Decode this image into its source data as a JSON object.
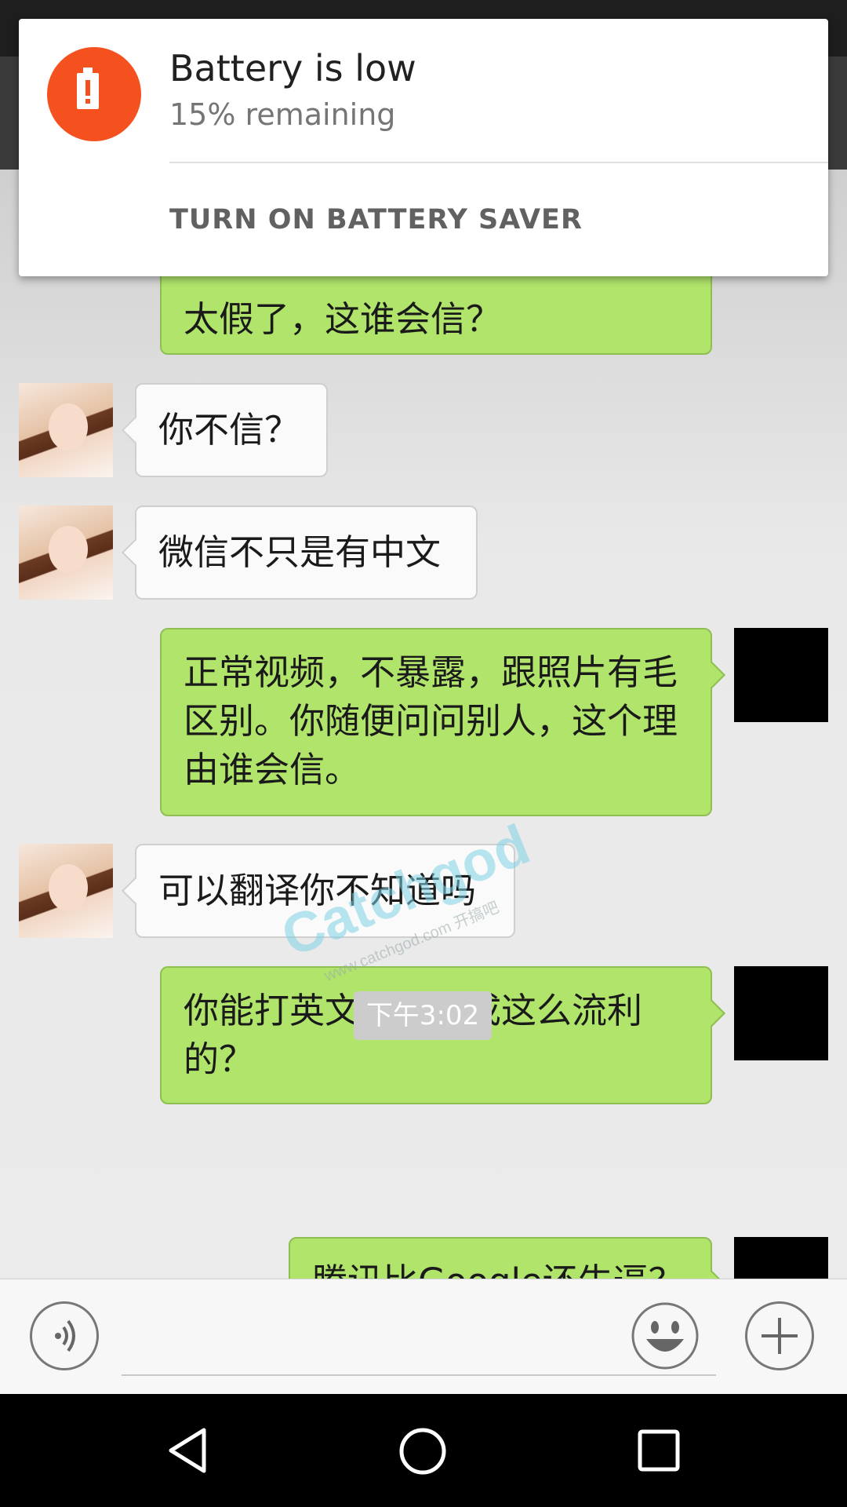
{
  "notification": {
    "title": "Battery is low",
    "subtitle": "15% remaining",
    "action": "TURN ON BATTERY SAVER",
    "accent": "#f4511e"
  },
  "messages": [
    {
      "side": "out",
      "text": "太假了，这谁会信？"
    },
    {
      "side": "in",
      "text": "你不信？"
    },
    {
      "side": "in",
      "text": "微信不只是有中文"
    },
    {
      "side": "out",
      "text": "正常视频，不暴露，跟照片有毛区别。你随便问问别人，这个理由谁会信。"
    },
    {
      "side": "in",
      "text": "可以翻译你不知道吗"
    },
    {
      "side": "out",
      "text": "你能打英文，翻译成这么流利的？"
    },
    {
      "side": "out",
      "text": "腾讯比Google还牛逼？"
    }
  ],
  "timestamp": "下午3:02",
  "watermark": {
    "brand": "Catchgod",
    "url": "www.catchgod.com 开搞吧"
  },
  "input_bar": {
    "voice_icon": "voice-icon",
    "emoji_icon": "emoji-icon",
    "plus_icon": "plus-icon"
  },
  "nav_bar": {
    "back_icon": "back-icon",
    "home_icon": "home-icon",
    "recents_icon": "recents-icon"
  },
  "colors": {
    "outgoing_bubble": "#b0e46b",
    "incoming_bubble": "#fafafa"
  }
}
